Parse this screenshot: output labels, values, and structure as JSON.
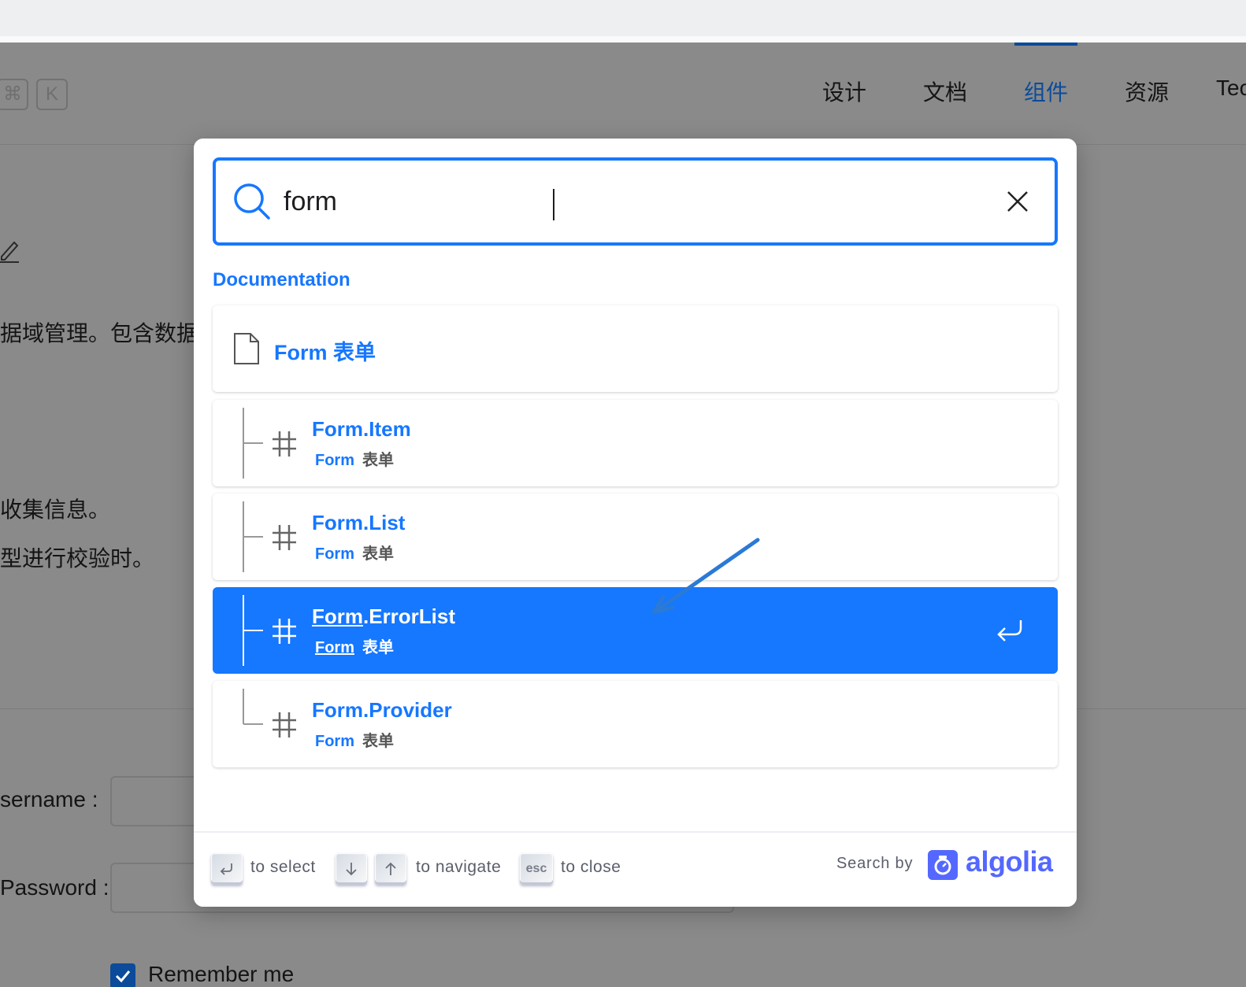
{
  "background": {
    "shortcut_keys": [
      "⌘",
      "K"
    ],
    "nav": [
      {
        "label": "设计",
        "active": false
      },
      {
        "label": "文档",
        "active": false
      },
      {
        "label": "组件",
        "active": true
      },
      {
        "label": "资源",
        "active": false
      },
      {
        "label": "Tec",
        "active": false
      }
    ],
    "text_lines": [
      "据域管理。包含数据",
      "收集信息。",
      "型进行校验时。"
    ],
    "form": {
      "username_label": "sername :",
      "password_label": "Password :",
      "remember_label": "Remember me"
    }
  },
  "search": {
    "query": "form",
    "section_title": "Documentation",
    "results": [
      {
        "type": "page",
        "title": "Form 表单"
      },
      {
        "type": "heading",
        "title_prefix": "Form",
        "title_suffix": ".Item",
        "path": "Form",
        "path_zh": "表单",
        "selected": false,
        "tree": "middle"
      },
      {
        "type": "heading",
        "title_prefix": "Form",
        "title_suffix": ".List",
        "path": "Form",
        "path_zh": "表单",
        "selected": false,
        "tree": "middle"
      },
      {
        "type": "heading",
        "title_prefix": "Form",
        "title_suffix": ".ErrorList",
        "path": "Form",
        "path_zh": "表单",
        "selected": true,
        "tree": "middle"
      },
      {
        "type": "heading",
        "title_prefix": "Form",
        "title_suffix": ".Provider",
        "path": "Form",
        "path_zh": "表单",
        "selected": false,
        "tree": "last"
      }
    ],
    "footer": {
      "select_label": "to select",
      "navigate_label": "to navigate",
      "esc_key": "esc",
      "close_label": "to close",
      "search_by": "Search by",
      "brand": "algolia"
    }
  },
  "colors": {
    "accent": "#1677ff",
    "algolia": "#5468ff",
    "annotation_arrow": "#2a7ad6"
  }
}
